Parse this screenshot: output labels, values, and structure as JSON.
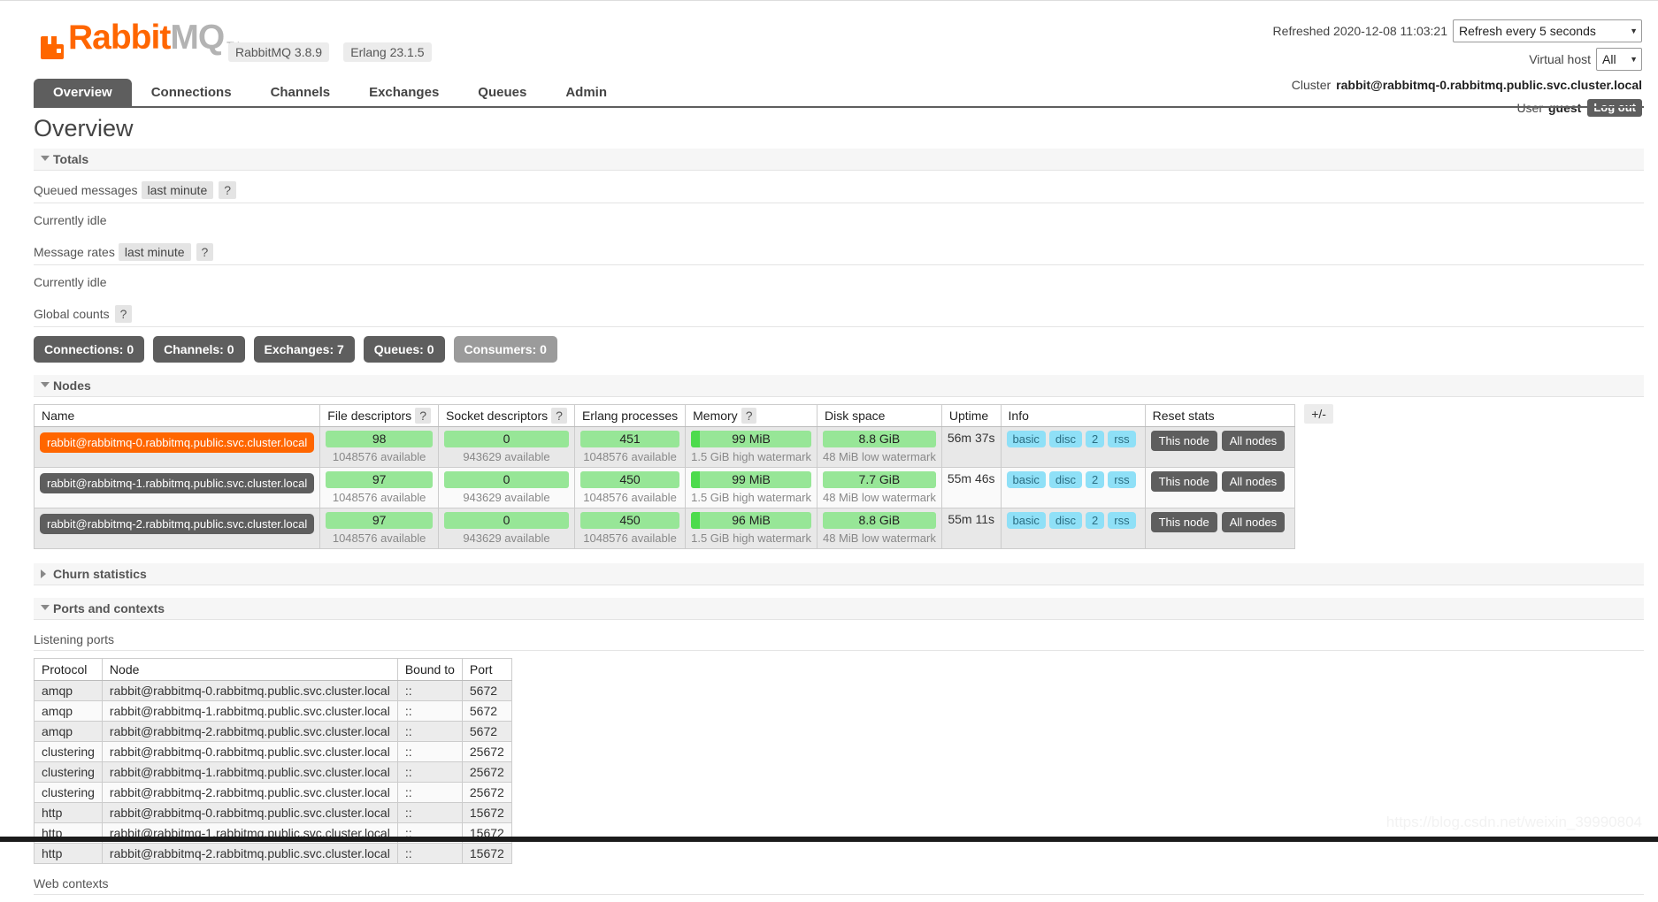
{
  "brand": {
    "name_part1": "Rabbit",
    "name_part2": "MQ",
    "tm": "TM",
    "version_pill": "RabbitMQ 3.8.9",
    "erlang_pill": "Erlang 23.1.5",
    "accent_color": "#ff6600"
  },
  "header": {
    "refreshed_label": "Refreshed 2020-12-08 11:03:21",
    "refresh_select_value": "Refresh every 5 seconds",
    "vhost_label": "Virtual host",
    "vhost_select_value": "All",
    "cluster_label": "Cluster",
    "cluster_name": "rabbit@rabbitmq-0.rabbitmq.public.svc.cluster.local",
    "user_label": "User",
    "user_name": "guest",
    "logout_label": "Log out"
  },
  "tabs": [
    {
      "label": "Overview",
      "active": true
    },
    {
      "label": "Connections",
      "active": false
    },
    {
      "label": "Channels",
      "active": false
    },
    {
      "label": "Exchanges",
      "active": false
    },
    {
      "label": "Queues",
      "active": false
    },
    {
      "label": "Admin",
      "active": false
    }
  ],
  "page": {
    "title": "Overview"
  },
  "totals": {
    "section_label": "Totals",
    "queued_messages_label": "Queued messages",
    "queued_messages_range": "last minute",
    "queued_messages_idle": "Currently idle",
    "message_rates_label": "Message rates",
    "message_rates_range": "last minute",
    "message_rates_idle": "Currently idle",
    "global_counts_label": "Global counts",
    "help_glyph": "?",
    "counts": [
      {
        "label": "Connections:",
        "value": "0",
        "muted": false
      },
      {
        "label": "Channels:",
        "value": "0",
        "muted": false
      },
      {
        "label": "Exchanges:",
        "value": "7",
        "muted": false
      },
      {
        "label": "Queues:",
        "value": "0",
        "muted": false
      },
      {
        "label": "Consumers:",
        "value": "0",
        "muted": true
      }
    ]
  },
  "nodes": {
    "section_label": "Nodes",
    "columns": [
      {
        "label": "Name",
        "help": false
      },
      {
        "label": "File descriptors",
        "help": true
      },
      {
        "label": "Socket descriptors",
        "help": true
      },
      {
        "label": "Erlang processes",
        "help": false
      },
      {
        "label": "Memory",
        "help": true
      },
      {
        "label": "Disk space",
        "help": false
      },
      {
        "label": "Uptime",
        "help": false
      },
      {
        "label": "Info",
        "help": false
      },
      {
        "label": "Reset stats",
        "help": false
      }
    ],
    "plus_minus_label": "+/-",
    "reset_this_node": "This node",
    "reset_all_nodes": "All nodes",
    "rows": [
      {
        "name": "rabbit@rabbitmq-0.rabbitmq.public.svc.cluster.local",
        "is_self": true,
        "fd_value": "98",
        "fd_sub": "1048576 available",
        "sd_value": "0",
        "sd_sub": "943629 available",
        "proc_value": "451",
        "proc_sub": "1048576 available",
        "mem_value": "99 MiB",
        "mem_sub": "1.5 GiB high watermark",
        "mem_pct": 7,
        "disk_value": "8.8 GiB",
        "disk_sub": "48 MiB low watermark",
        "uptime": "56m 37s",
        "info_tags": [
          "basic",
          "disc",
          "2",
          "rss"
        ]
      },
      {
        "name": "rabbit@rabbitmq-1.rabbitmq.public.svc.cluster.local",
        "is_self": false,
        "fd_value": "97",
        "fd_sub": "1048576 available",
        "sd_value": "0",
        "sd_sub": "943629 available",
        "proc_value": "450",
        "proc_sub": "1048576 available",
        "mem_value": "99 MiB",
        "mem_sub": "1.5 GiB high watermark",
        "mem_pct": 7,
        "disk_value": "7.7 GiB",
        "disk_sub": "48 MiB low watermark",
        "uptime": "55m 46s",
        "info_tags": [
          "basic",
          "disc",
          "2",
          "rss"
        ]
      },
      {
        "name": "rabbit@rabbitmq-2.rabbitmq.public.svc.cluster.local",
        "is_self": false,
        "fd_value": "97",
        "fd_sub": "1048576 available",
        "sd_value": "0",
        "sd_sub": "943629 available",
        "proc_value": "450",
        "proc_sub": "1048576 available",
        "mem_value": "96 MiB",
        "mem_sub": "1.5 GiB high watermark",
        "mem_pct": 7,
        "disk_value": "8.8 GiB",
        "disk_sub": "48 MiB low watermark",
        "uptime": "55m 11s",
        "info_tags": [
          "basic",
          "disc",
          "2",
          "rss"
        ]
      }
    ]
  },
  "churn": {
    "section_label": "Churn statistics"
  },
  "ports": {
    "section_label": "Ports and contexts",
    "listening_ports_label": "Listening ports",
    "web_contexts_label": "Web contexts",
    "columns": [
      "Protocol",
      "Node",
      "Bound to",
      "Port"
    ],
    "rows": [
      {
        "protocol": "amqp",
        "node": "rabbit@rabbitmq-0.rabbitmq.public.svc.cluster.local",
        "bound_to": "::",
        "port": "5672"
      },
      {
        "protocol": "amqp",
        "node": "rabbit@rabbitmq-1.rabbitmq.public.svc.cluster.local",
        "bound_to": "::",
        "port": "5672"
      },
      {
        "protocol": "amqp",
        "node": "rabbit@rabbitmq-2.rabbitmq.public.svc.cluster.local",
        "bound_to": "::",
        "port": "5672"
      },
      {
        "protocol": "clustering",
        "node": "rabbit@rabbitmq-0.rabbitmq.public.svc.cluster.local",
        "bound_to": "::",
        "port": "25672"
      },
      {
        "protocol": "clustering",
        "node": "rabbit@rabbitmq-1.rabbitmq.public.svc.cluster.local",
        "bound_to": "::",
        "port": "25672"
      },
      {
        "protocol": "clustering",
        "node": "rabbit@rabbitmq-2.rabbitmq.public.svc.cluster.local",
        "bound_to": "::",
        "port": "25672"
      },
      {
        "protocol": "http",
        "node": "rabbit@rabbitmq-0.rabbitmq.public.svc.cluster.local",
        "bound_to": "::",
        "port": "15672"
      },
      {
        "protocol": "http",
        "node": "rabbit@rabbitmq-1.rabbitmq.public.svc.cluster.local",
        "bound_to": "::",
        "port": "15672"
      },
      {
        "protocol": "http",
        "node": "rabbit@rabbitmq-2.rabbitmq.public.svc.cluster.local",
        "bound_to": "::",
        "port": "15672"
      }
    ]
  },
  "watermark": {
    "text": "https://blog.csdn.net/weixin_39990804"
  }
}
